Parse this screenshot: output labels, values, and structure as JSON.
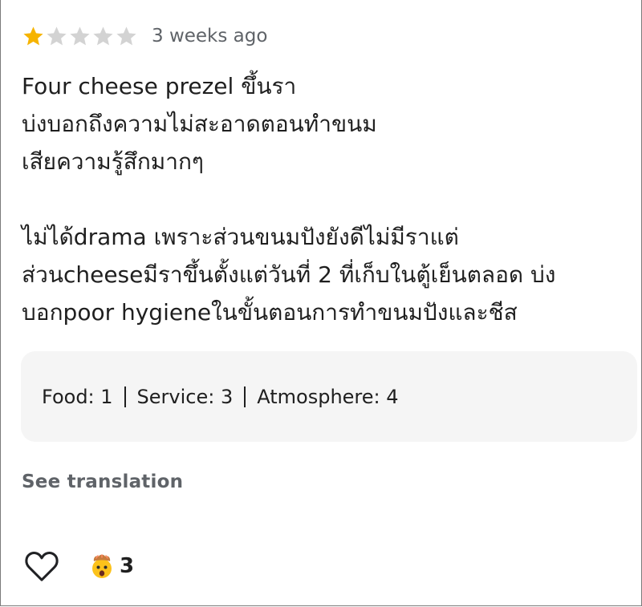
{
  "review": {
    "rating": 1,
    "max_rating": 5,
    "colors": {
      "star_filled": "#f6b400",
      "star_empty": "#d3d3d3"
    },
    "time": "3 weeks ago",
    "text": "Four cheese prezel ขึ้นรา\nบ่งบอกถึงความไม่สะอาดตอนทำขนม\nเสียความรู้สึกมากๆ\n\nไม่ได้drama เพราะส่วนขนมปังยังดีไม่มีราแต่\nส่วนcheeseมีราขึ้นตั้งแต่วันที่ 2 ที่เก็บในตู้เย็นตลอด บ่ง\nบอกpoor hygieneในขั้นตอนการทำขนมปังและชีส",
    "sub_ratings": {
      "food": "Food: 1",
      "service": "Service: 3",
      "atmosphere": "Atmosphere: 4"
    },
    "see_translation": "See translation",
    "reactions": {
      "like_icon": "heart-outline-icon",
      "emoji_icon": "mind-blown-emoji-icon",
      "count": "3"
    }
  }
}
